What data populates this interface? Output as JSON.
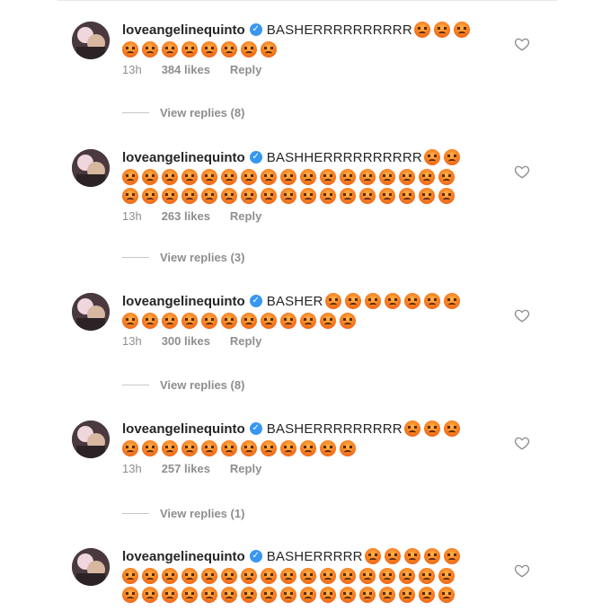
{
  "comments": [
    {
      "username": "loveangelinequinto",
      "text": "BASHERRRRRRRRRR",
      "inline_emoji_count": 3,
      "rows": [
        8
      ],
      "time": "13h",
      "likes": "384 likes",
      "reply_label": "Reply",
      "view_replies": "View replies (8)"
    },
    {
      "username": "loveangelinequinto",
      "text": "BASHHERRRRRRRRRR",
      "inline_emoji_count": 2,
      "rows": [
        17,
        17
      ],
      "time": "13h",
      "likes": "263 likes",
      "reply_label": "Reply",
      "view_replies": "View replies (3)"
    },
    {
      "username": "loveangelinequinto",
      "text": "BASHER",
      "inline_emoji_count": 7,
      "rows": [
        12
      ],
      "time": "13h",
      "likes": "300 likes",
      "reply_label": "Reply",
      "view_replies": "View replies (8)"
    },
    {
      "username": "loveangelinequinto",
      "text": "BASHERRRRRRRRR",
      "inline_emoji_count": 3,
      "rows": [
        12
      ],
      "time": "13h",
      "likes": "257 likes",
      "reply_label": "Reply",
      "view_replies": "View replies (1)"
    },
    {
      "username": "loveangelinequinto",
      "text": "BASHERRRRR",
      "inline_emoji_count": 5,
      "rows": [
        17,
        17
      ],
      "time": "",
      "likes": "",
      "reply_label": "",
      "view_replies": ""
    }
  ],
  "icons": {
    "like": "heart-outline-icon",
    "verified": "verified-badge-icon",
    "emoji": "angry-face-emoji"
  },
  "colors": {
    "verified": "#3897f0",
    "muted": "#8e8e8e",
    "text": "#262626"
  }
}
